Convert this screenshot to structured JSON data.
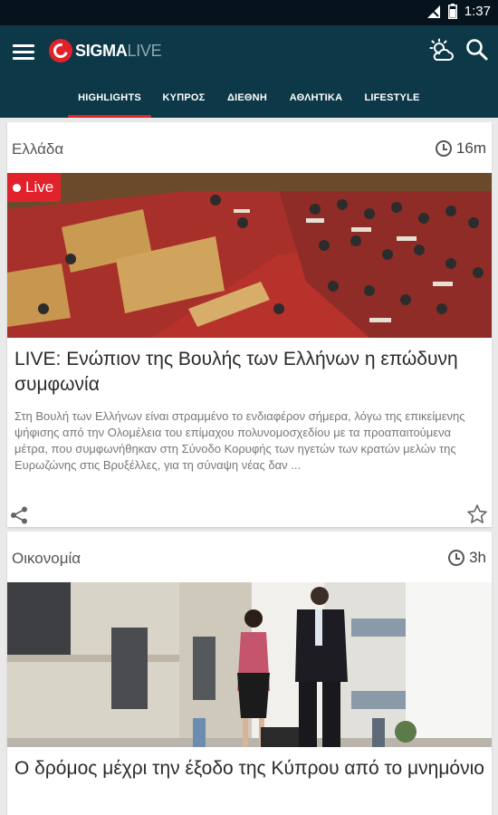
{
  "statusbar": {
    "time": "1:37"
  },
  "header": {
    "logo_bold": "SIGMA",
    "logo_light": "LIVE",
    "icons": [
      "menu-icon",
      "weather-icon",
      "search-icon"
    ]
  },
  "tabs": [
    {
      "label": "HIGHLIGHTS",
      "active": true
    },
    {
      "label": "ΚΥΠΡΟΣ",
      "active": false
    },
    {
      "label": "ΔΙΕΘΝΗ",
      "active": false
    },
    {
      "label": "ΑΘΛΗΤΙΚΑ",
      "active": false
    },
    {
      "label": "LIFESTYLE",
      "active": false
    }
  ],
  "articles": [
    {
      "category": "Ελλάδα",
      "time_ago": "16m",
      "badge": "Live",
      "title": "LIVE: Ενώπιον της Βουλής των Ελλήνων η επώδυνη συμφωνία",
      "summary": "Στη Βουλή των Ελλήνων είναι στραμμένο το ενδιαφέρον σήμερα, λόγω της επικείμενης ψήφισης από την Ολομέλεια  του επίμαχου  πολυνομοσχεδίου με τα προαπαιτούμενα μέτρα, που συμφωνήθηκαν στη Σύνοδο Κορυφής των ηγετών των κρατών μελών της Ευρωζώνης στις Βρυξέλλες, για τη σύναψη νέας δαν ..."
    },
    {
      "category": "Οικονομία",
      "time_ago": "3h",
      "title": "Ο δρόμος μέχρι την έξοδο της Κύπρου από το μνημόνιο"
    }
  ],
  "colors": {
    "appbar": "#0d3847",
    "accent": "#e2222b",
    "statusbar": "#06131c"
  }
}
